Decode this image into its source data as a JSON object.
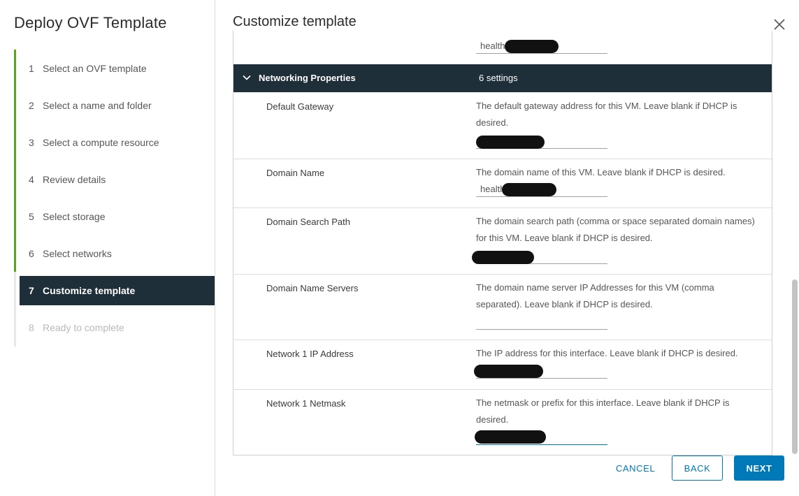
{
  "wizard": {
    "title": "Deploy OVF Template",
    "steps": [
      {
        "num": "1",
        "label": "Select an OVF template"
      },
      {
        "num": "2",
        "label": "Select a name and folder"
      },
      {
        "num": "3",
        "label": "Select a compute resource"
      },
      {
        "num": "4",
        "label": "Review details"
      },
      {
        "num": "5",
        "label": "Select storage"
      },
      {
        "num": "6",
        "label": "Select networks"
      },
      {
        "num": "7",
        "label": "Customize template"
      },
      {
        "num": "8",
        "label": "Ready to complete"
      }
    ],
    "active_step": 7
  },
  "main": {
    "title": "Customize template",
    "top_field_value": "health",
    "group": {
      "title": "Networking Properties",
      "count": "6 settings"
    },
    "properties": [
      {
        "label": "Default Gateway",
        "description": "The default gateway address for this VM. Leave blank if DHCP is desired.",
        "value": ""
      },
      {
        "label": "Domain Name",
        "description": "The domain name of this VM. Leave blank if DHCP is desired.",
        "value": "health"
      },
      {
        "label": "Domain Search Path",
        "description": "The domain search path (comma or space separated domain names) for this VM. Leave blank if DHCP is desired.",
        "value": ""
      },
      {
        "label": "Domain Name Servers",
        "description": "The domain name server IP Addresses for this VM (comma separated). Leave blank if DHCP is desired.",
        "value": ""
      },
      {
        "label": "Network 1 IP Address",
        "description": "The IP address for this interface. Leave blank if DHCP is desired.",
        "value": ""
      },
      {
        "label": "Network 1 Netmask",
        "description": "The netmask or prefix for this interface. Leave blank if DHCP is desired.",
        "value": ""
      }
    ]
  },
  "footer": {
    "cancel_label": "CANCEL",
    "back_label": "BACK",
    "next_label": "NEXT"
  },
  "colors": {
    "accent": "#0079b8",
    "header_dark": "#1f2f3a",
    "step_done_bar": "#5aa220"
  },
  "icons": {
    "close": "close-icon",
    "group_toggle": "chevron-down-icon"
  }
}
